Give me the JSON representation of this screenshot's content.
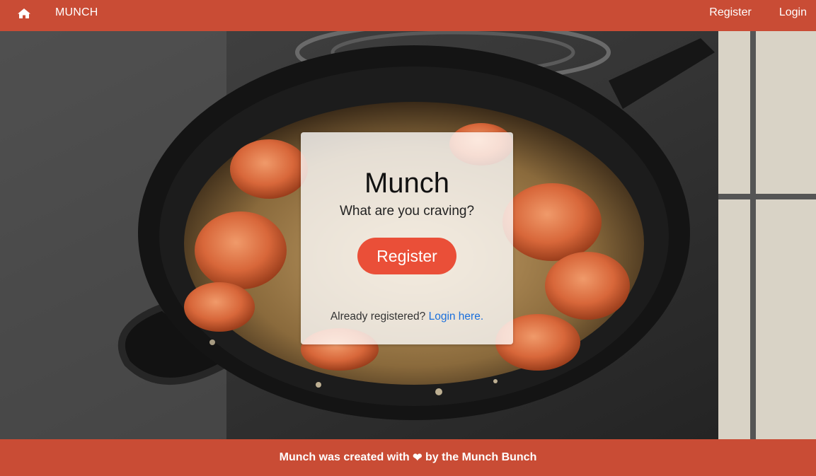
{
  "navbar": {
    "home_icon": "home-icon",
    "brand": "MUNCH",
    "register_label": "Register",
    "login_label": "Login"
  },
  "card": {
    "title": "Munch",
    "subtitle": "What are you craving?",
    "register_button": "Register",
    "login_prompt": "Already registered?",
    "login_link": "Login here."
  },
  "footer": {
    "text_before": "Munch was created with",
    "heart_icon": "heart-icon",
    "heart_glyph": "❤",
    "text_after": "by the Munch Bunch"
  },
  "colors": {
    "brand": "#c94c35",
    "button": "#ea4f38",
    "link": "#1a6fdc"
  }
}
